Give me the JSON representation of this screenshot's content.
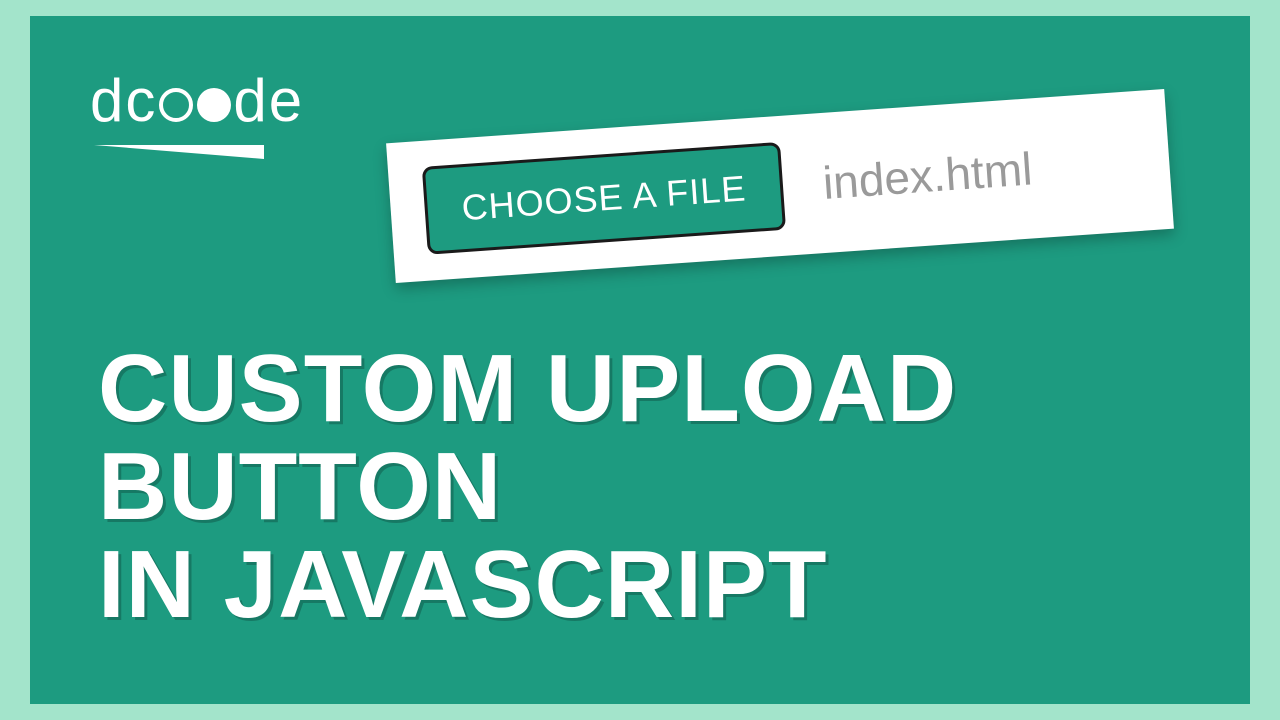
{
  "logo": {
    "text_prefix": "dc",
    "text_suffix": "de"
  },
  "card": {
    "button_label": "CHOOSE A FILE",
    "filename": "index.html"
  },
  "headline": {
    "line1": "CUSTOM UPLOAD BUTTON",
    "line2": "IN JAVASCRIPT"
  }
}
